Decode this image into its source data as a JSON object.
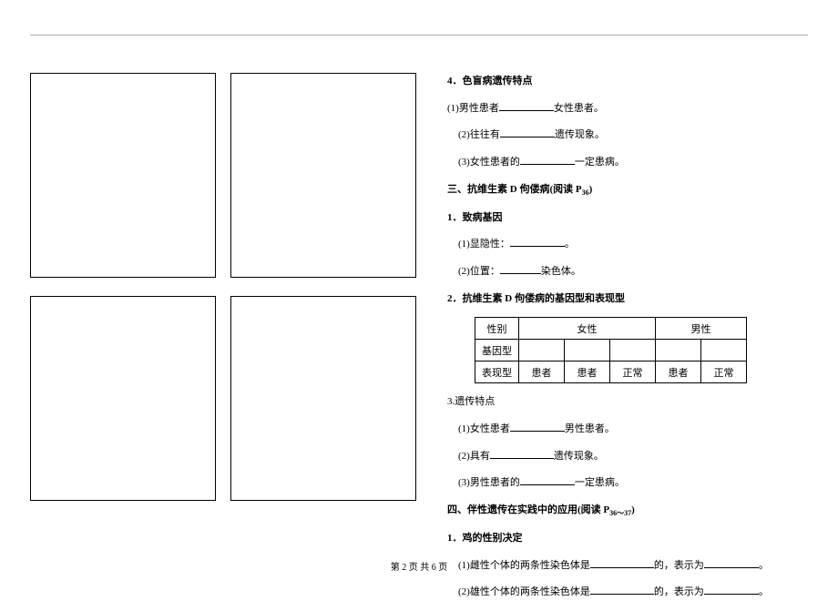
{
  "section4": {
    "heading": "4．色盲病遗传特点",
    "item1_before": "(1)男性患者",
    "item1_after": "女性患者。",
    "item2_before": "(2)往往有",
    "item2_after": "遗传现象。",
    "item3_before": "(3)女性患者的",
    "item3_after": "一定患病。"
  },
  "section3": {
    "heading_before": "三、抗维生素 D 佝偻病(阅读 P",
    "heading_sub": "36",
    "heading_after": ")",
    "sub1": {
      "heading": "1．致病基因",
      "item1_before": "(1)显隐性：",
      "item1_after": "。",
      "item2_before": "(2)位置：",
      "item2_after": "染色体。"
    },
    "sub2": {
      "heading": "2．抗维生素 D 佝偻病的基因型和表现型",
      "table": {
        "r1c1": "性别",
        "r1c2": "女性",
        "r1c3": "男性",
        "r2c1": "基因型",
        "r3c1": "表现型",
        "r3c2": "患者",
        "r3c3": "患者",
        "r3c4": "正常",
        "r3c5": "患者",
        "r3c6": "正常"
      }
    },
    "sub3": {
      "heading": "3.遗传特点",
      "item1_before": "(1)女性患者",
      "item1_after": "男性患者。",
      "item2_before": "(2)具有",
      "item2_after": "遗传现象。",
      "item3_before": "(3)男性患者的",
      "item3_after": "一定患病。"
    }
  },
  "section4big": {
    "heading_before": "四、伴性遗传在实践中的应用(阅读 P",
    "heading_sub": "36～37",
    "heading_after": ")",
    "sub1": {
      "heading": "1．鸡的性别决定",
      "item1_before": "(1)雌性个体的两条性染色体是",
      "item1_mid": "的，表示为",
      "item1_after": "。",
      "item2_before": "(2)雄性个体的两条性染色体是",
      "item2_mid": "的，表示为",
      "item2_after": "。"
    }
  },
  "footer": "第 2 页 共 6 页"
}
